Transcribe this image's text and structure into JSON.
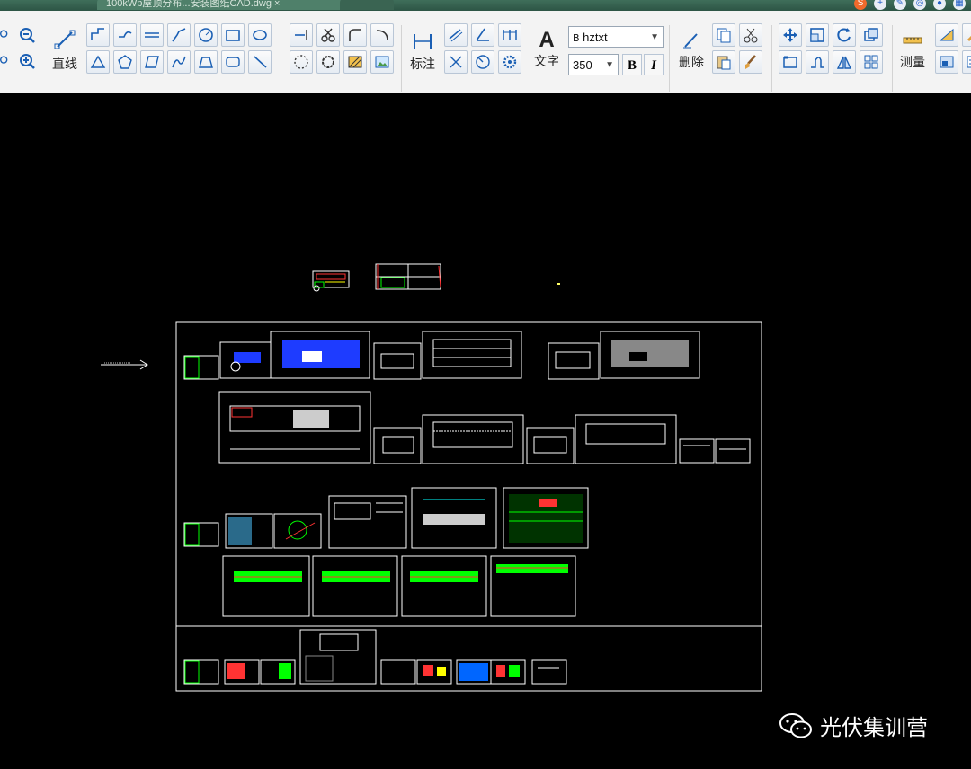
{
  "window": {
    "tabs": [
      {
        "label": "100kWp屋顶分布...安装图纸CAD.dwg ×"
      },
      {
        "label": ""
      }
    ]
  },
  "toolbar": {
    "line_label": "直线",
    "dimension_label": "标注",
    "text_label": "文字",
    "delete_label": "删除",
    "measure_label": "测量",
    "text_style": "hztxt",
    "text_height": "350",
    "bold_label": "B",
    "italic_label": "I",
    "icons": [
      "zoom-in-icon",
      "zoom-out-icon",
      "line-icon",
      "polyline-icon",
      "rectangle-icon",
      "circle-icon",
      "arc-icon",
      "move-icon",
      "rotate-icon",
      "copy-icon",
      "cut-icon",
      "paste-icon",
      "match-properties-icon",
      "mirror-icon",
      "array-icon"
    ]
  },
  "canvas": {
    "background": "#000000",
    "frame_color": "#ffffff",
    "accent_green": "#00ff00",
    "accent_blue": "#1e3cff"
  },
  "watermark": {
    "text": "光伏集训营"
  }
}
